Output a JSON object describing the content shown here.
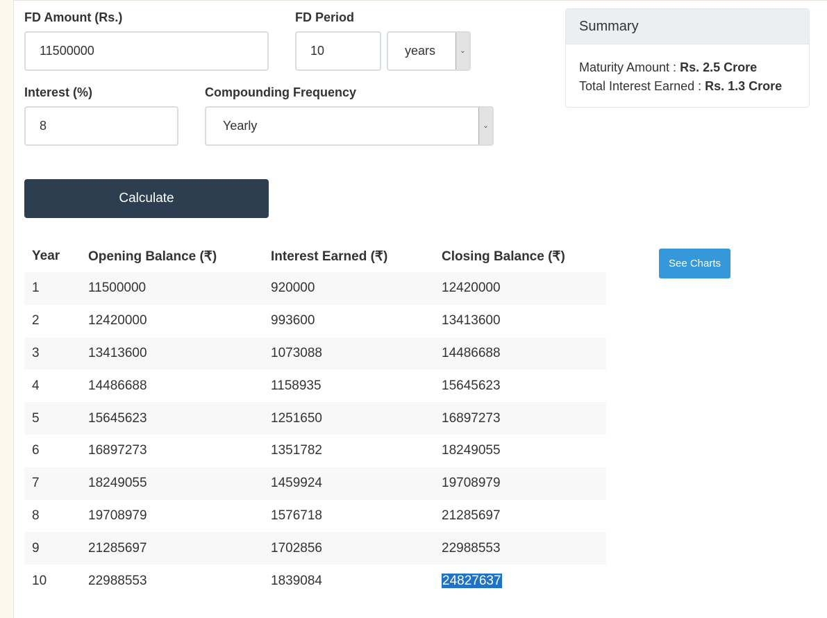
{
  "form": {
    "amount_label": "FD Amount (Rs.)",
    "amount_value": "11500000",
    "period_label": "FD Period",
    "period_value": "10",
    "period_unit": "years",
    "interest_label": "Interest (%)",
    "interest_value": "8",
    "frequency_label": "Compounding Frequency",
    "frequency_value": "Yearly",
    "calculate_label": "Calculate"
  },
  "summary": {
    "title": "Summary",
    "maturity_label": "Maturity Amount :",
    "maturity_value": "Rs. 2.5 Crore",
    "interest_label": "Total Interest Earned :",
    "interest_value": "Rs. 1.3 Crore"
  },
  "charts_button": "See Charts",
  "table": {
    "headers": [
      "Year",
      "Opening Balance (₹)",
      "Interest Earned (₹)",
      "Closing Balance (₹)"
    ],
    "rows": [
      [
        "1",
        "11500000",
        "920000",
        "12420000"
      ],
      [
        "2",
        "12420000",
        "993600",
        "13413600"
      ],
      [
        "3",
        "13413600",
        "1073088",
        "14486688"
      ],
      [
        "4",
        "14486688",
        "1158935",
        "15645623"
      ],
      [
        "5",
        "15645623",
        "1251650",
        "16897273"
      ],
      [
        "6",
        "16897273",
        "1351782",
        "18249055"
      ],
      [
        "7",
        "18249055",
        "1459924",
        "19708979"
      ],
      [
        "8",
        "19708979",
        "1576718",
        "21285697"
      ],
      [
        "9",
        "21285697",
        "1702856",
        "22988553"
      ],
      [
        "10",
        "22988553",
        "1839084",
        "24827637"
      ]
    ]
  },
  "colors": {
    "calculate_button": "#2d3e50",
    "charts_button": "#3498db",
    "selection": "#1f72c7"
  }
}
